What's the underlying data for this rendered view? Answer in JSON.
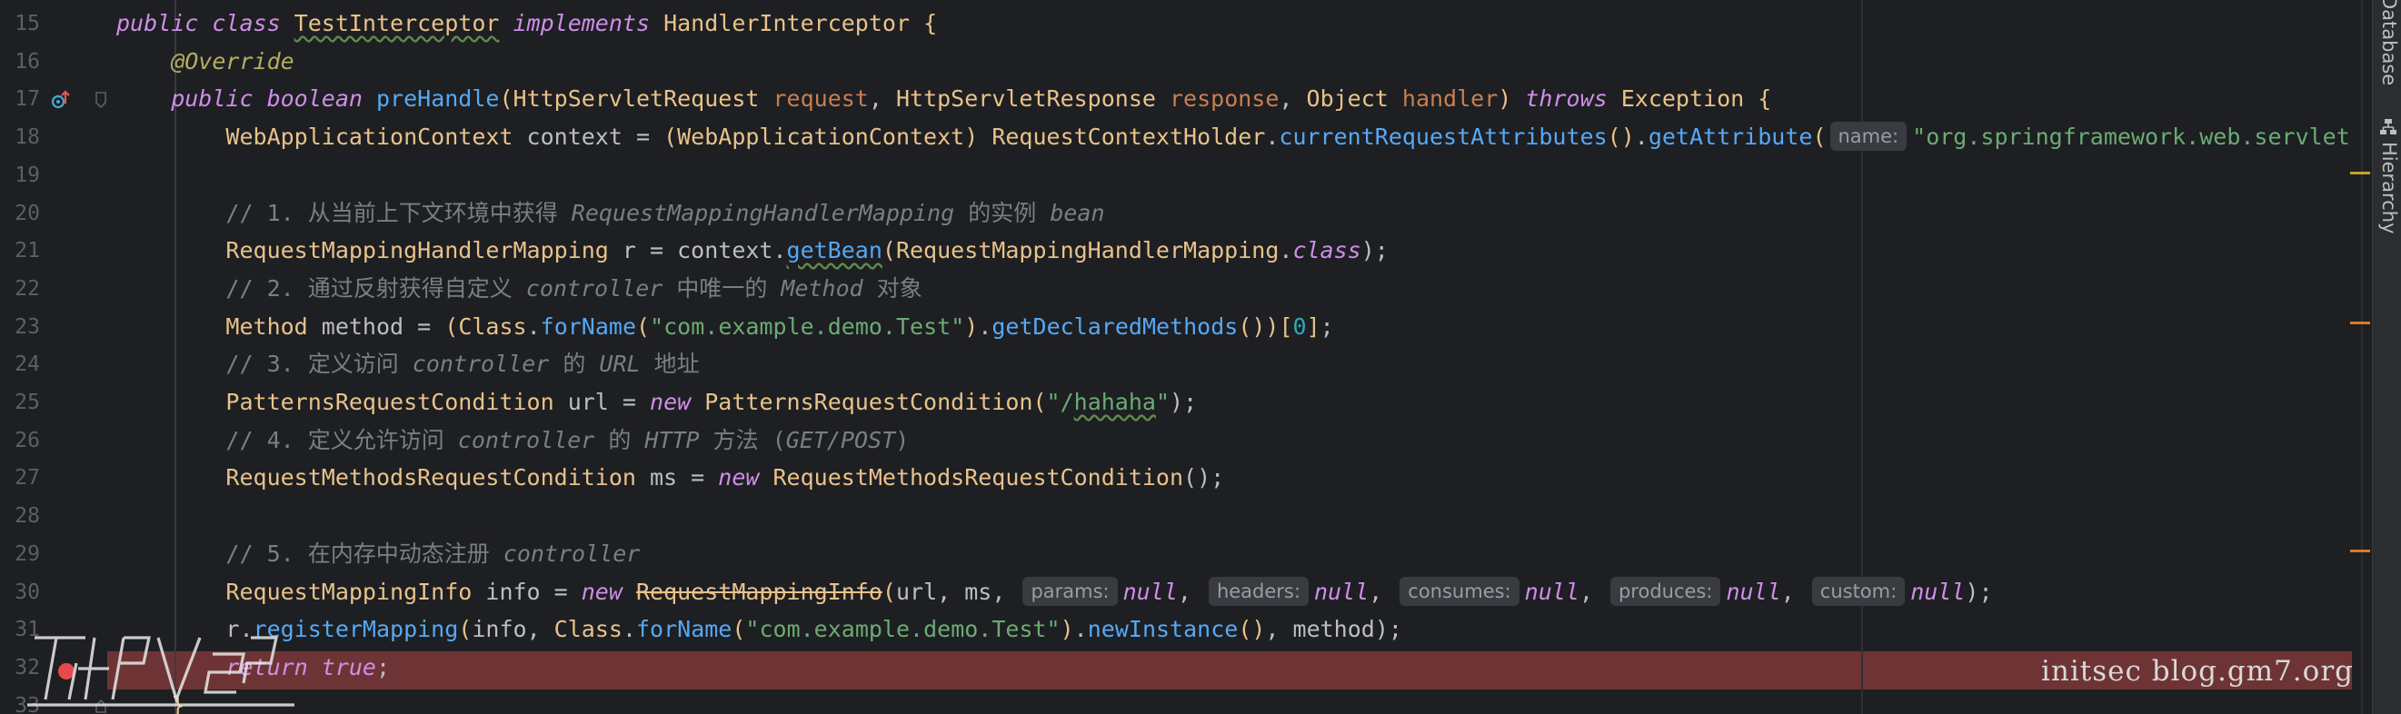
{
  "colors": {
    "background": "#1e1f22",
    "line_number": "#5c5f66",
    "keyword": "#cf8ee8",
    "annotation": "#b3ae60",
    "class_name": "#e8c28a",
    "method_call": "#56a8f5",
    "parameter": "#c77f50",
    "string": "#6aab73",
    "comment": "#7a7e85",
    "plain": "#bcbec4",
    "number": "#2aacb8",
    "breakpoint_line": "#6e3435"
  },
  "editor": {
    "lines": [
      {
        "num": "15",
        "tokens": [
          {
            "t": "public class ",
            "c": "kw",
            "i": true
          },
          {
            "t": "TestInterceptor",
            "c": "cls",
            "u": true
          },
          {
            "t": " implements ",
            "c": "kw",
            "i": true
          },
          {
            "t": "HandlerInterceptor ",
            "c": "cls"
          },
          {
            "t": "{",
            "c": "brace"
          }
        ]
      },
      {
        "num": "16",
        "tokens": [
          {
            "t": "    @Override",
            "c": "ann",
            "i": true
          }
        ]
      },
      {
        "num": "17",
        "tokens": [
          {
            "t": "    public boolean ",
            "c": "kw",
            "i": true
          },
          {
            "t": "preHandle",
            "c": "mth"
          },
          {
            "t": "(",
            "c": "brace"
          },
          {
            "t": "HttpServletRequest ",
            "c": "cls"
          },
          {
            "t": "request",
            "c": "par"
          },
          {
            "t": ", ",
            "c": "pl"
          },
          {
            "t": "HttpServletResponse ",
            "c": "cls"
          },
          {
            "t": "response",
            "c": "par"
          },
          {
            "t": ", ",
            "c": "pl"
          },
          {
            "t": "Object ",
            "c": "cls"
          },
          {
            "t": "handler",
            "c": "par"
          },
          {
            "t": ") ",
            "c": "brace"
          },
          {
            "t": "throws ",
            "c": "kw",
            "i": true
          },
          {
            "t": "Exception ",
            "c": "cls"
          },
          {
            "t": "{",
            "c": "brace"
          }
        ]
      },
      {
        "num": "18",
        "tokens": [
          {
            "t": "        WebApplicationContext ",
            "c": "cls"
          },
          {
            "t": "context = ",
            "c": "pl"
          },
          {
            "t": "(",
            "c": "brace"
          },
          {
            "t": "WebApplicationContext",
            "c": "cls"
          },
          {
            "t": ") ",
            "c": "brace"
          },
          {
            "t": "RequestContextHolder",
            "c": "cls"
          },
          {
            "t": ".",
            "c": "pl"
          },
          {
            "t": "currentRequestAttributes",
            "c": "mth"
          },
          {
            "t": "()",
            "c": "brace"
          },
          {
            "t": ".",
            "c": "pl"
          },
          {
            "t": "getAttribute",
            "c": "mth"
          },
          {
            "t": "(",
            "c": "brace"
          },
          {
            "t": "name:",
            "c": "hint"
          },
          {
            "t": "\"org.springframework.web.servlet.DispatcherServlet.CONTEXT\"",
            "c": "str"
          }
        ]
      },
      {
        "num": "19",
        "tokens": []
      },
      {
        "num": "20",
        "tokens": [
          {
            "t": "        // 1. 从当前上下文环境中获得 ",
            "c": "cmt"
          },
          {
            "t": "RequestMappingHandlerMapping",
            "c": "cmt",
            "i": true
          },
          {
            "t": " 的实例 ",
            "c": "cmt"
          },
          {
            "t": "bean",
            "c": "cmt",
            "i": true
          }
        ]
      },
      {
        "num": "21",
        "tokens": [
          {
            "t": "        RequestMappingHandlerMapping ",
            "c": "cls"
          },
          {
            "t": "r = context.",
            "c": "pl"
          },
          {
            "t": "getBean",
            "c": "mth",
            "u": true
          },
          {
            "t": "(",
            "c": "brace"
          },
          {
            "t": "RequestMappingHandlerMapping",
            "c": "cls"
          },
          {
            "t": ".",
            "c": "pl"
          },
          {
            "t": "class",
            "c": "kw",
            "i": true
          },
          {
            "t": ");",
            "c": "pl"
          }
        ]
      },
      {
        "num": "22",
        "tokens": [
          {
            "t": "        // 2. 通过反射获得自定义 ",
            "c": "cmt"
          },
          {
            "t": "controller",
            "c": "cmt",
            "i": true
          },
          {
            "t": " 中唯一的 ",
            "c": "cmt"
          },
          {
            "t": "Method",
            "c": "cmt",
            "i": true
          },
          {
            "t": " 对象",
            "c": "cmt"
          }
        ]
      },
      {
        "num": "23",
        "tokens": [
          {
            "t": "        Method ",
            "c": "cls"
          },
          {
            "t": "method = ",
            "c": "pl"
          },
          {
            "t": "(",
            "c": "brace"
          },
          {
            "t": "Class",
            "c": "cls"
          },
          {
            "t": ".",
            "c": "pl"
          },
          {
            "t": "forName",
            "c": "mth"
          },
          {
            "t": "(",
            "c": "brace"
          },
          {
            "t": "\"com.example.demo.Test\"",
            "c": "str"
          },
          {
            "t": ")",
            "c": "brace"
          },
          {
            "t": ".",
            "c": "pl"
          },
          {
            "t": "getDeclaredMethods",
            "c": "mth"
          },
          {
            "t": "())",
            "c": "brace"
          },
          {
            "t": "[",
            "c": "brace"
          },
          {
            "t": "0",
            "c": "num"
          },
          {
            "t": "]",
            "c": "brace"
          },
          {
            "t": ";",
            "c": "pl"
          }
        ]
      },
      {
        "num": "24",
        "tokens": [
          {
            "t": "        // 3. 定义访问 ",
            "c": "cmt"
          },
          {
            "t": "controller",
            "c": "cmt",
            "i": true
          },
          {
            "t": " 的 ",
            "c": "cmt"
          },
          {
            "t": "URL",
            "c": "cmt",
            "i": true
          },
          {
            "t": " 地址",
            "c": "cmt"
          }
        ]
      },
      {
        "num": "25",
        "tokens": [
          {
            "t": "        PatternsRequestCondition ",
            "c": "cls"
          },
          {
            "t": "url = ",
            "c": "pl"
          },
          {
            "t": "new ",
            "c": "kw",
            "i": true
          },
          {
            "t": "PatternsRequestCondition",
            "c": "cls"
          },
          {
            "t": "(",
            "c": "brace"
          },
          {
            "t": "\"/",
            "c": "str"
          },
          {
            "t": "hahaha",
            "c": "str",
            "u": true
          },
          {
            "t": "\"",
            "c": "str"
          },
          {
            "t": ");",
            "c": "pl"
          }
        ]
      },
      {
        "num": "26",
        "tokens": [
          {
            "t": "        // 4. 定义允许访问 ",
            "c": "cmt"
          },
          {
            "t": "controller",
            "c": "cmt",
            "i": true
          },
          {
            "t": " 的 ",
            "c": "cmt"
          },
          {
            "t": "HTTP",
            "c": "cmt",
            "i": true
          },
          {
            "t": " 方法 (",
            "c": "cmt"
          },
          {
            "t": "GET/POST",
            "c": "cmt",
            "i": true
          },
          {
            "t": ")",
            "c": "cmt"
          }
        ]
      },
      {
        "num": "27",
        "tokens": [
          {
            "t": "        RequestMethodsRequestCondition ",
            "c": "cls"
          },
          {
            "t": "ms = ",
            "c": "pl"
          },
          {
            "t": "new ",
            "c": "kw",
            "i": true
          },
          {
            "t": "RequestMethodsRequestCondition",
            "c": "cls"
          },
          {
            "t": "();",
            "c": "pl"
          }
        ]
      },
      {
        "num": "28",
        "tokens": []
      },
      {
        "num": "29",
        "tokens": [
          {
            "t": "        // 5. 在内存中动态注册 ",
            "c": "cmt"
          },
          {
            "t": "controller",
            "c": "cmt",
            "i": true
          }
        ]
      },
      {
        "num": "30",
        "tokens": [
          {
            "t": "        RequestMappingInfo ",
            "c": "cls"
          },
          {
            "t": "info = ",
            "c": "pl"
          },
          {
            "t": "new ",
            "c": "kw",
            "i": true
          },
          {
            "t": "RequestMappingInfo",
            "c": "cls",
            "s": true
          },
          {
            "t": "(",
            "c": "brace"
          },
          {
            "t": "url, ms, ",
            "c": "pl"
          },
          {
            "t": "params:",
            "c": "hint"
          },
          {
            "t": "null",
            "c": "kw",
            "i": true
          },
          {
            "t": ", ",
            "c": "pl"
          },
          {
            "t": "headers:",
            "c": "hint"
          },
          {
            "t": "null",
            "c": "kw",
            "i": true
          },
          {
            "t": ", ",
            "c": "pl"
          },
          {
            "t": "consumes:",
            "c": "hint"
          },
          {
            "t": "null",
            "c": "kw",
            "i": true
          },
          {
            "t": ", ",
            "c": "pl"
          },
          {
            "t": "produces:",
            "c": "hint"
          },
          {
            "t": "null",
            "c": "kw",
            "i": true
          },
          {
            "t": ", ",
            "c": "pl"
          },
          {
            "t": "custom:",
            "c": "hint"
          },
          {
            "t": "null",
            "c": "kw",
            "i": true
          },
          {
            "t": ");",
            "c": "pl"
          }
        ]
      },
      {
        "num": "31",
        "tokens": [
          {
            "t": "        r.",
            "c": "pl"
          },
          {
            "t": "registerMapping",
            "c": "mth"
          },
          {
            "t": "(",
            "c": "brace"
          },
          {
            "t": "info, ",
            "c": "pl"
          },
          {
            "t": "Class",
            "c": "cls"
          },
          {
            "t": ".",
            "c": "pl"
          },
          {
            "t": "forName",
            "c": "mth"
          },
          {
            "t": "(",
            "c": "brace"
          },
          {
            "t": "\"com.example.demo.Test\"",
            "c": "str"
          },
          {
            "t": ")",
            "c": "brace"
          },
          {
            "t": ".",
            "c": "pl"
          },
          {
            "t": "newInstance",
            "c": "mth"
          },
          {
            "t": "()",
            "c": "brace"
          },
          {
            "t": ", method);",
            "c": "pl"
          }
        ]
      },
      {
        "num": "32",
        "tokens": [
          {
            "t": "        return ",
            "c": "kw",
            "i": true
          },
          {
            "t": "true",
            "c": "kw",
            "i": true
          },
          {
            "t": ";",
            "c": "pl"
          }
        ]
      },
      {
        "num": "33",
        "tokens": [
          {
            "t": "    }",
            "c": "brace"
          }
        ]
      }
    ]
  },
  "gutter_icons": {
    "line17": "override-implement-icon",
    "line32": "breakpoint-icon"
  },
  "right_panel": {
    "tabs": [
      "Database",
      "Hierarchy"
    ]
  },
  "watermark": {
    "text": "initsec blog.gm7.org"
  },
  "scroll_marks": [
    {
      "at": 0.24,
      "color": "#c9a227"
    },
    {
      "at": 0.45,
      "color": "#d77a2d"
    },
    {
      "at": 0.77,
      "color": "#d77a2d"
    }
  ]
}
